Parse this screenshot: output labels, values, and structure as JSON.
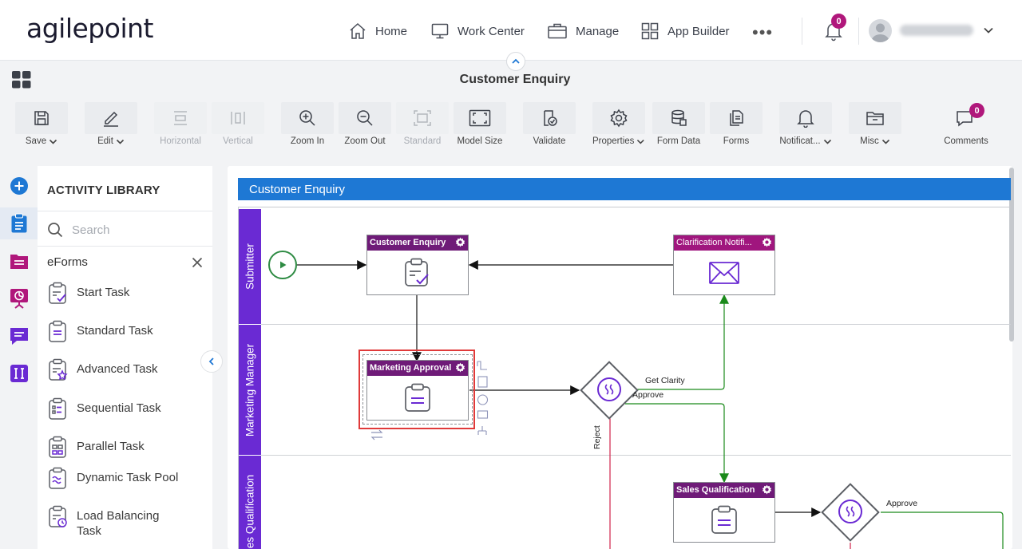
{
  "brand": {
    "logo_text": "agilepoint"
  },
  "nav": {
    "items": [
      {
        "label": "Home"
      },
      {
        "label": "Work Center"
      },
      {
        "label": "Manage"
      },
      {
        "label": "App Builder"
      }
    ],
    "more": "•••",
    "notification_count": "0"
  },
  "page": {
    "title": "Customer Enquiry"
  },
  "toolbar": {
    "items": [
      {
        "label": "Save",
        "dropdown": true
      },
      {
        "label": "Edit",
        "dropdown": true
      },
      {
        "label": "Horizontal",
        "disabled": true
      },
      {
        "label": "Vertical",
        "disabled": true
      },
      {
        "label": "Zoom In"
      },
      {
        "label": "Zoom Out"
      },
      {
        "label": "Standard",
        "disabled": true
      },
      {
        "label": "Model Size"
      },
      {
        "label": "Validate"
      },
      {
        "label": "Properties",
        "dropdown": true
      },
      {
        "label": "Form Data"
      },
      {
        "label": "Forms"
      },
      {
        "label": "Notificat...",
        "dropdown": true
      },
      {
        "label": "Misc",
        "dropdown": true
      },
      {
        "label": "Comments"
      }
    ],
    "comments_count": "0"
  },
  "library": {
    "title": "ACTIVITY LIBRARY",
    "search_placeholder": "Search",
    "category": "eForms",
    "items": [
      {
        "label": "Start Task"
      },
      {
        "label": "Standard Task"
      },
      {
        "label": "Advanced Task"
      },
      {
        "label": "Sequential Task"
      },
      {
        "label": "Parallel Task"
      },
      {
        "label": "Dynamic Task Pool"
      },
      {
        "label": "Load Balancing Task"
      }
    ]
  },
  "canvas": {
    "pool_title": "Customer Enquiry",
    "lanes": [
      {
        "label": "Submitter"
      },
      {
        "label": "Marketing Manager"
      },
      {
        "label": "es Qualification"
      }
    ],
    "tasks": {
      "customer_enquiry": "Customer Enquiry",
      "clarification": "Clarification Notifi...",
      "marketing_approval": "Marketing Approval",
      "sales_qualification": "Sales Qualification"
    },
    "flow_labels": {
      "get_clarity": "Get Clarity",
      "approve_1": "Approve",
      "reject": "Reject",
      "approve_2": "Approve"
    }
  },
  "colors": {
    "pool_header": "#1e78d4",
    "lane": "#6a2ad3",
    "task_header": "#6f1b78",
    "notify_header": "#a0167e",
    "green_flow": "#1a8a1a",
    "red_flow": "#d0224a",
    "badge": "#b0177b"
  }
}
